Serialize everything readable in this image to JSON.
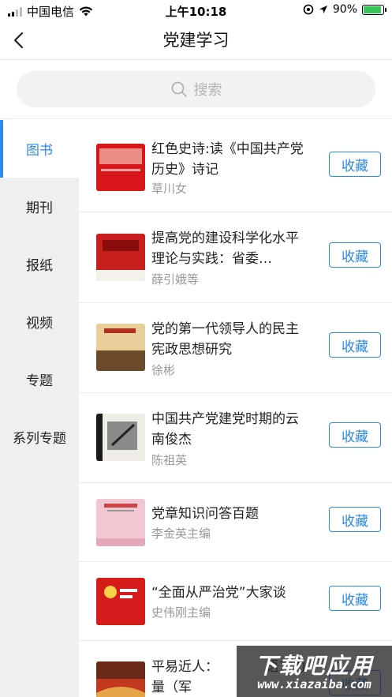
{
  "status_bar": {
    "carrier": "中国电信",
    "time": "上午10:18",
    "battery_percent": "90%",
    "battery_level": 0.9
  },
  "nav": {
    "title": "党建学习"
  },
  "search": {
    "placeholder": "搜索"
  },
  "sidebar": {
    "items": [
      {
        "label": "图书",
        "active": true
      },
      {
        "label": "期刊",
        "active": false
      },
      {
        "label": "报纸",
        "active": false
      },
      {
        "label": "视频",
        "active": false
      },
      {
        "label": "专题",
        "active": false
      },
      {
        "label": "系列专题",
        "active": false
      }
    ]
  },
  "books": [
    {
      "title": "红色史诗:读《中国共产党历史》诗记",
      "author": "草川女",
      "button": "收藏"
    },
    {
      "title": "提高党的建设科学化水平理论与实践：省委…",
      "author": "薛引娥等",
      "button": "收藏"
    },
    {
      "title": "党的第一代领导人的民主宪政思想研究",
      "author": "徐彬",
      "button": "收藏"
    },
    {
      "title": "中国共产党建党时期的云南俊杰",
      "author": "陈祖英",
      "button": "收藏"
    },
    {
      "title": "党章知识问答百题",
      "author": "李金英主编",
      "button": "收藏"
    },
    {
      "title": "“全面从严治党”大家谈",
      "author": "史伟刚主编",
      "button": "收藏"
    },
    {
      "title": "平易近人：　　　　语言力量（军",
      "author": "",
      "button": "收藏"
    }
  ],
  "watermark": {
    "title": "下载吧应用",
    "url": "www.xiazaiba.com"
  },
  "colors": {
    "accent": "#2b8ae6",
    "sidebar_bg": "#efefef",
    "battery": "#35c759"
  }
}
